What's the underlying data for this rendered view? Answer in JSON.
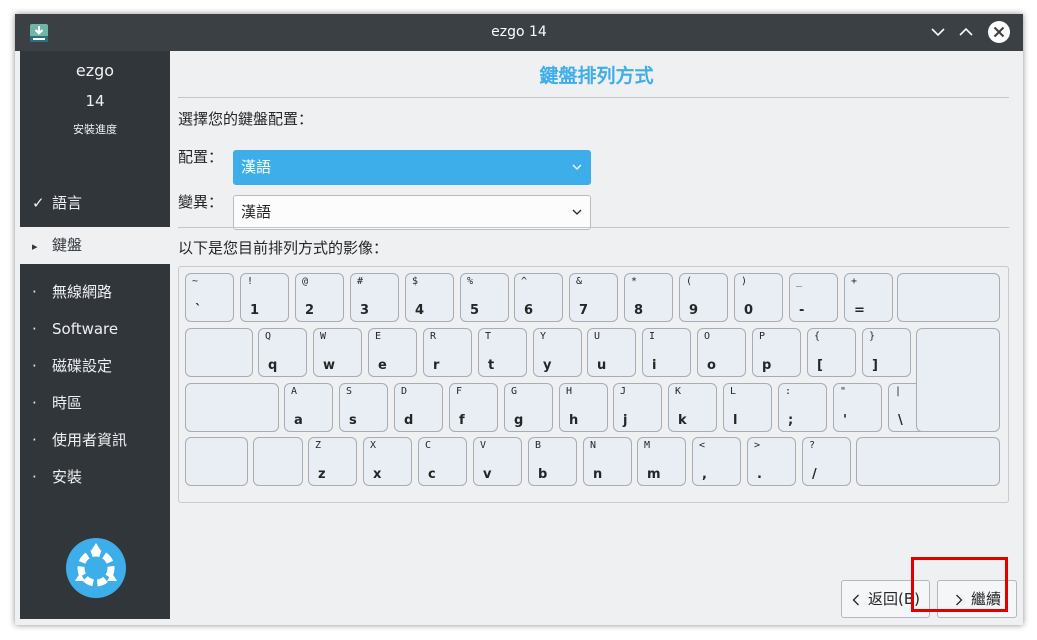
{
  "window": {
    "title": "ezgo 14"
  },
  "sidebar": {
    "product": "ezgo",
    "version": "14",
    "progress_label": "安裝進度",
    "steps": [
      {
        "mark": "✓",
        "label": "語言",
        "state": "done"
      },
      {
        "mark": "▸",
        "label": "鍵盤",
        "state": "current"
      },
      {
        "mark": "·",
        "label": "無線網路",
        "state": "pending"
      },
      {
        "mark": "·",
        "label": "Software",
        "state": "pending"
      },
      {
        "mark": "·",
        "label": "磁碟設定",
        "state": "pending"
      },
      {
        "mark": "·",
        "label": "時區",
        "state": "pending"
      },
      {
        "mark": "·",
        "label": "使用者資訊",
        "state": "pending"
      },
      {
        "mark": "·",
        "label": "安裝",
        "state": "pending"
      }
    ]
  },
  "main": {
    "title": "鍵盤排列方式",
    "choose_label": "選擇您的鍵盤配置：",
    "layout_label": "配置：",
    "layout_value": "漢語",
    "variant_label": "變異：",
    "variant_value": "漢語",
    "preview_label": "以下是您目前排列方式的影像："
  },
  "keyboard": {
    "rows": [
      [
        [
          "~",
          "`"
        ],
        [
          "!",
          "1"
        ],
        [
          "@",
          "2"
        ],
        [
          "#",
          "3"
        ],
        [
          "$",
          "4"
        ],
        [
          "%",
          "5"
        ],
        [
          "^",
          "6"
        ],
        [
          "&",
          "7"
        ],
        [
          "*",
          "8"
        ],
        [
          "(",
          "9"
        ],
        [
          ")",
          "0"
        ],
        [
          "_",
          "-"
        ],
        [
          "+",
          "="
        ]
      ],
      [
        [
          "Q",
          "q"
        ],
        [
          "W",
          "w"
        ],
        [
          "E",
          "e"
        ],
        [
          "R",
          "r"
        ],
        [
          "T",
          "t"
        ],
        [
          "Y",
          "y"
        ],
        [
          "U",
          "u"
        ],
        [
          "I",
          "i"
        ],
        [
          "O",
          "o"
        ],
        [
          "P",
          "p"
        ],
        [
          "{",
          "["
        ],
        [
          "}",
          "]"
        ]
      ],
      [
        [
          "A",
          "a"
        ],
        [
          "S",
          "s"
        ],
        [
          "D",
          "d"
        ],
        [
          "F",
          "f"
        ],
        [
          "G",
          "g"
        ],
        [
          "H",
          "h"
        ],
        [
          "J",
          "j"
        ],
        [
          "K",
          "k"
        ],
        [
          "L",
          "l"
        ],
        [
          ":",
          ";"
        ],
        [
          "\"",
          "'"
        ],
        [
          "|",
          "\\"
        ]
      ],
      [
        [
          "Z",
          "z"
        ],
        [
          "X",
          "x"
        ],
        [
          "C",
          "c"
        ],
        [
          "V",
          "v"
        ],
        [
          "B",
          "b"
        ],
        [
          "N",
          "n"
        ],
        [
          "M",
          "m"
        ],
        [
          "<",
          ","
        ],
        [
          ">",
          "."
        ],
        [
          "?",
          "/"
        ]
      ]
    ]
  },
  "buttons": {
    "back": "返回(B)",
    "next": "繼續"
  },
  "colors": {
    "accent": "#3daee9",
    "sidebar_bg": "#31363b",
    "highlight": "#e00000"
  }
}
